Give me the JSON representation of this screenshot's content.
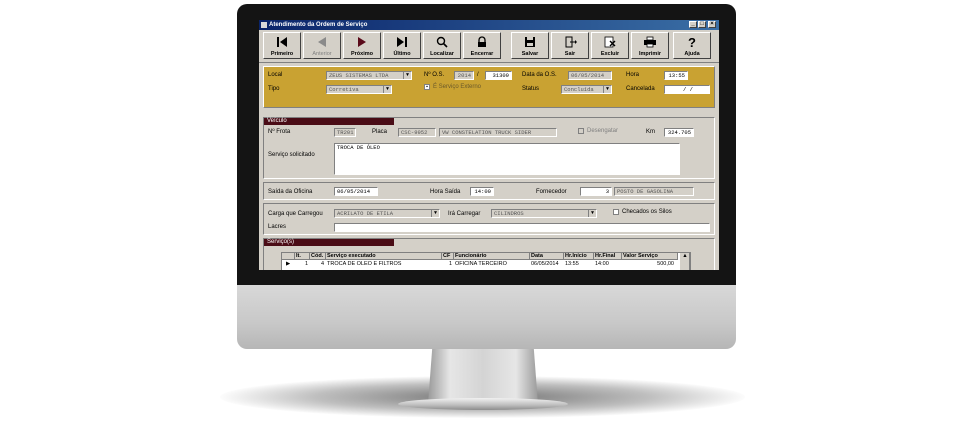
{
  "window": {
    "title": "Atendimento da Ordem de Serviço"
  },
  "toolbar": [
    {
      "label": "Primeiro",
      "icon": "first-record-icon",
      "enabled": true
    },
    {
      "label": "Anterior",
      "icon": "previous-record-icon",
      "enabled": false
    },
    {
      "label": "Próximo",
      "icon": "next-record-icon",
      "enabled": true
    },
    {
      "label": "Último",
      "icon": "last-record-icon",
      "enabled": true
    },
    {
      "label": "Localizar",
      "icon": "magnifier-icon",
      "enabled": true
    },
    {
      "label": "Encerrar",
      "icon": "padlock-icon",
      "enabled": true
    },
    {
      "label": "Salvar",
      "icon": "floppy-disk-icon",
      "enabled": true
    },
    {
      "label": "Sair",
      "icon": "exit-door-icon",
      "enabled": true
    },
    {
      "label": "Excluir",
      "icon": "delete-document-icon",
      "enabled": true
    },
    {
      "label": "Imprimir",
      "icon": "printer-icon",
      "enabled": true
    },
    {
      "label": "Ajuda",
      "icon": "help-question-icon",
      "enabled": true
    }
  ],
  "header": {
    "local_label": "Local",
    "local_value": "ZEUS SISTEMAS LTDA",
    "os_label": "Nº O.S.",
    "os_year": "2014",
    "os_sep": "/",
    "os_number": "31309",
    "date_label": "Data da O.S.",
    "date_value": "06/05/2014",
    "hora_label": "Hora",
    "hora_value": "13:55",
    "tipo_label": "Tipo",
    "tipo_value": "Corretiva",
    "externo_label": "É Serviço Externo",
    "status_label": "Status",
    "status_value": "Concluída",
    "cancelada_label": "Cancelada",
    "cancelada_value": "/  /"
  },
  "veiculo": {
    "title": "Veículo",
    "frota_label": "Nº Frota",
    "frota_value": "TR201",
    "placa_label": "Placa",
    "placa_value": "CSC-9952",
    "modelo_value": "VW CONSTELATION TRUCK SIDER",
    "desengatar_label": "Desengatar",
    "km_label": "Km",
    "km_value": "324.705",
    "servico_label": "Serviço solicitado",
    "servico_value": "TROCA DE ÓLEO"
  },
  "oficina": {
    "saida_label": "Saída da Oficina",
    "saida_value": "06/05/2014",
    "hora_saida_label": "Hora Saída",
    "hora_saida_value": "14:00",
    "fornecedor_label": "Fornecedor",
    "fornecedor_code": "3",
    "fornecedor_name": "POSTO DE GASOLINA"
  },
  "carga": {
    "carregou_label": "Carga que Carregou",
    "carregou_value": "ACRILATO DE ETILA",
    "ira_label": "Irá Carregar",
    "ira_value": "CILINDROS",
    "silos_label": "Checados os Silos",
    "lacres_label": "Lacres",
    "lacres_value": ""
  },
  "servicos": {
    "title": "Serviço(s)",
    "columns": [
      "It.",
      "Cód.",
      "Serviço executado",
      "CF",
      "Funcionário",
      "Data",
      "Hr.Início",
      "Hr.Final",
      "Valor Serviço"
    ],
    "rows": [
      [
        "1",
        "4",
        "TROCA DE ÓLEO E FILTROS",
        "1",
        "OFICINA TERCEIRO",
        "06/05/2014",
        "13:55",
        "14:00",
        "500,00"
      ]
    ]
  }
}
